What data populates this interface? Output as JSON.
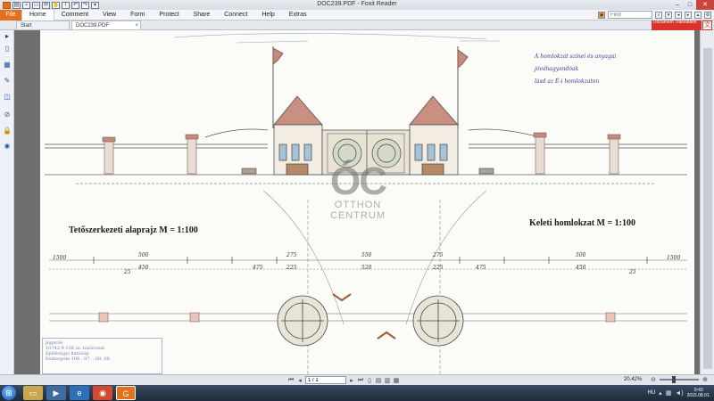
{
  "window": {
    "title": "DOC239.PDF - Foxit Reader"
  },
  "ribbon": {
    "file_label": "File",
    "tabs": [
      "Home",
      "Comment",
      "View",
      "Form",
      "Protect",
      "Share",
      "Connect",
      "Help",
      "Extras"
    ],
    "find_placeholder": "Find"
  },
  "doc_tabs": {
    "start_label": "Start",
    "active_label": "DOC239.PDF",
    "close_glyph": "×"
  },
  "doc_translation": {
    "label": "Document Translation"
  },
  "drawing": {
    "label_left": "Tetőszerkezeti alaprajz  M = 1:100",
    "label_right": "Keleti homlokzat  M = 1:100",
    "note_line1": "A homlokzat színei és anyagai",
    "note_line2": "jóváhagyandóak",
    "note_line3": "lásd az É-i homlokzaton",
    "dim_1500": "1500",
    "dim_500": "500",
    "dim_450": "450",
    "dim_475": "475",
    "dim_275": "275",
    "dim_225": "225",
    "dim_25": "25",
    "dim_550": "550",
    "dim_520": "520"
  },
  "watermark": {
    "logo": "ÓC",
    "line1": "OTTHON",
    "line2": "CENTRUM"
  },
  "stamp": {
    "line1": "Jogerős",
    "line2": "10742-9   106   sz. határozat",
    "line3": "Építésügyi hatóság",
    "line4": "Esztergom 106 . 07. . 08. 09."
  },
  "statusbar": {
    "page_display": "1 / 1",
    "zoom": "20.42%"
  },
  "taskbar": {
    "lang": "HU",
    "time": "9:43",
    "date": "2015.08.01."
  }
}
